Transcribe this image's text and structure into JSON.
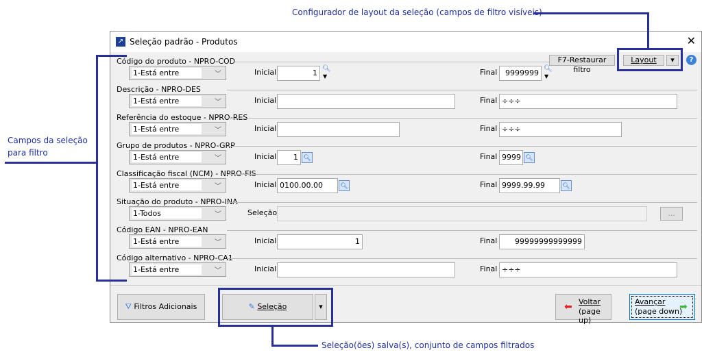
{
  "dialog": {
    "title": "Seleção padrão - Produtos",
    "close": "✕"
  },
  "toolbar": {
    "restore": "F7-Restaurar filtro",
    "layout": "Layout",
    "dropdown": "▾",
    "help": "?"
  },
  "labels": {
    "initial": "Inicial",
    "final": "Final",
    "selection": "Seleção",
    "ellipsis": "..."
  },
  "rows": [
    {
      "label": "Código do produto - NPRO-COD",
      "operator": "1-Está entre",
      "initial": "1",
      "final": "9999999"
    },
    {
      "label": "Descrição - NPRO-DES",
      "operator": "1-Está entre",
      "initial": "",
      "final": "÷÷÷"
    },
    {
      "label": "Referência do estoque - NPRO-RES",
      "operator": "1-Está entre",
      "initial": "",
      "final": "÷÷÷"
    },
    {
      "label": "Grupo de produtos - NPRO-GRP",
      "operator": "1-Está entre",
      "initial": "1",
      "final": "9999"
    },
    {
      "label": "Classificação fiscal (NCM) - NPRO-FIS",
      "operator": "1-Está entre",
      "initial": "0100.00.00",
      "final": "9999.99.99"
    },
    {
      "label": "Situação do produto - NPRO-INA",
      "operator": "1-Todos",
      "selection": ""
    },
    {
      "label": "Código EAN - NPRO-EAN",
      "operator": "1-Está entre",
      "initial": "1",
      "final": "99999999999999"
    },
    {
      "label": "Código alternativo - NPRO-CA1",
      "operator": "1-Está entre",
      "initial": "",
      "final": "÷÷÷"
    }
  ],
  "footer": {
    "extra_filters": "Filtros Adicionais",
    "selection": "Seleção",
    "back": "Voltar",
    "back_sub": "(page up)",
    "next": "Avançar",
    "next_sub": "(page down)"
  },
  "annotations": {
    "layout": "Configurador de layout da seleção (campos de filtro visíveis)",
    "fields_1": "Campos da seleção",
    "fields_2": "para filtro",
    "saved": "Seleção(ões) salva(s), conjunto de campos filtrados"
  },
  "colors": {
    "annotation": "#27309a",
    "background": "#f0f0f0"
  }
}
